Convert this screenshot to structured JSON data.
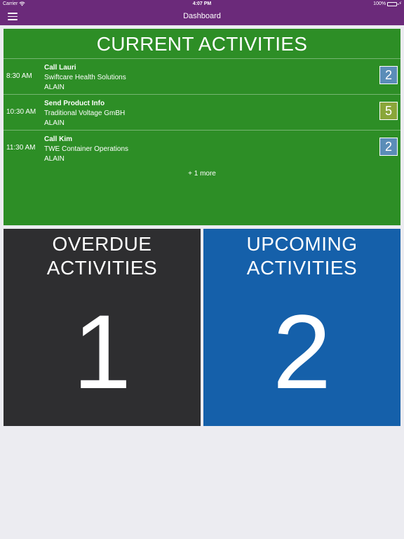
{
  "status_bar": {
    "carrier": "Carrier",
    "time": "4:07 PM",
    "battery": "100%"
  },
  "nav": {
    "title": "Dashboard"
  },
  "current": {
    "title": "CURRENT ACTIVITIES",
    "items": [
      {
        "time": "8:30 AM",
        "name": "Call Lauri",
        "company": "Swiftcare Health Solutions",
        "owner": "ALAIN",
        "badge": "2",
        "badge_color": "#5b8db8"
      },
      {
        "time": "10:30 AM",
        "name": "Send Product Info",
        "company": "Traditional Voltage GmBH",
        "owner": "ALAIN",
        "badge": "5",
        "badge_color": "#8aa63a"
      },
      {
        "time": "11:30 AM",
        "name": "Call Kim",
        "company": "TWE Container Operations",
        "owner": "ALAIN",
        "badge": "2",
        "badge_color": "#5b8db8"
      }
    ],
    "more": "+ 1 more"
  },
  "overdue": {
    "title_line1": "OVERDUE",
    "title_line2": "ACTIVITIES",
    "count": "1"
  },
  "upcoming": {
    "title_line1": "UPCOMING",
    "title_line2": "ACTIVITIES",
    "count": "2"
  },
  "colors": {
    "header": "#6b2a7a",
    "current": "#2d8e26",
    "overdue": "#2e2e30",
    "upcoming": "#1560aa",
    "background": "#ececf1"
  }
}
